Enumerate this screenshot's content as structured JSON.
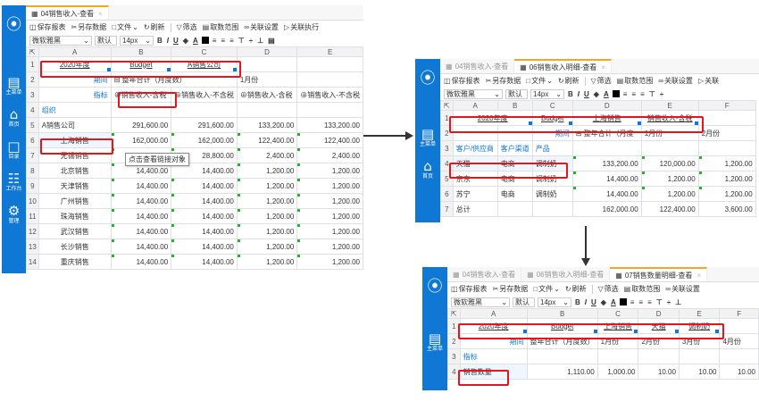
{
  "p1": {
    "tab": "04销售收入-查看",
    "toolbar": [
      "保存报表",
      "另存数据",
      "文件",
      "刷新",
      "筛选",
      "取数范围",
      "关联设置",
      "关联执行"
    ],
    "font": "微软雅黑",
    "style": "默认",
    "size": "14px",
    "cols": [
      "A",
      "B",
      "C",
      "D",
      "E"
    ],
    "rows": [
      {
        "n": "1",
        "c": [
          "2020年度",
          "Budget",
          "A销售公司",
          "",
          ""
        ]
      },
      {
        "n": "2",
        "c": [
          "期间",
          "⊟ 整年合计（月度数）",
          "",
          "1月份",
          ""
        ]
      },
      {
        "n": "3",
        "c": [
          "指标",
          "⊕销售收入-含税",
          "⊕销售收入-不含税",
          "⊕销售收入-含税",
          "⊕销售收入-不含税"
        ]
      },
      {
        "n": "4",
        "c": [
          "组织",
          "",
          "",
          "",
          ""
        ]
      },
      {
        "n": "5",
        "c": [
          "A销售公司",
          "291,600.00",
          "291,600.00",
          "133,200.00",
          "133,200.00"
        ]
      },
      {
        "n": "6",
        "c": [
          "上海销售",
          "162,000.00",
          "162,000.00",
          "122,400.00",
          "122,400.00"
        ]
      },
      {
        "n": "7",
        "c": [
          "无锡销售",
          "",
          "28,800.00",
          "2,400.00",
          "2,400.00"
        ]
      },
      {
        "n": "8",
        "c": [
          "北京销售",
          "14,400.00",
          "14,400.00",
          "1,200.00",
          "1,200.00"
        ]
      },
      {
        "n": "9",
        "c": [
          "天津销售",
          "14,400.00",
          "14,400.00",
          "1,200.00",
          "1,200.00"
        ]
      },
      {
        "n": "10",
        "c": [
          "广州销售",
          "14,400.00",
          "14,400.00",
          "1,200.00",
          "1,200.00"
        ]
      },
      {
        "n": "11",
        "c": [
          "珠海销售",
          "14,400.00",
          "14,400.00",
          "1,200.00",
          "1,200.00"
        ]
      },
      {
        "n": "12",
        "c": [
          "武汉销售",
          "14,400.00",
          "14,400.00",
          "1,200.00",
          "1,200.00"
        ]
      },
      {
        "n": "13",
        "c": [
          "长沙销售",
          "14,400.00",
          "14,400.00",
          "1,200.00",
          "1,200.00"
        ]
      },
      {
        "n": "14",
        "c": [
          "重庆销售",
          "14,400.00",
          "14,400.00",
          "1,200.00",
          "1,200.00"
        ]
      }
    ],
    "tooltip": "点击查看链接对象",
    "nav": [
      "主菜单",
      "首页",
      "目录",
      "工作台",
      "管理"
    ]
  },
  "p2": {
    "tabs": [
      "04销售收入-查看",
      "06销售收入明细-查看"
    ],
    "toolbar": [
      "保存报表",
      "另存数据",
      "文件",
      "刷新",
      "筛选",
      "取数范围",
      "关联设置",
      "关联"
    ],
    "font": "微软雅黑",
    "style": "默认",
    "size": "14px",
    "cols": [
      "A",
      "B",
      "C",
      "D",
      "E",
      "F"
    ],
    "rows": [
      {
        "n": "1",
        "c": [
          "2020年度",
          "",
          "Budget",
          "上海销售",
          "销售收入-含税",
          ""
        ]
      },
      {
        "n": "2",
        "c": [
          "",
          "",
          "期间",
          "⊟ 整年合计（月度",
          "1月份",
          "2月份"
        ]
      },
      {
        "n": "3",
        "c": [
          "客户/供应商",
          "客户渠道",
          "产品",
          "",
          "",
          ""
        ]
      },
      {
        "n": "4",
        "c": [
          "天猫",
          "电商",
          "调制奶",
          "133,200.00",
          "120,000.00",
          "1,200.00"
        ]
      },
      {
        "n": "5",
        "c": [
          "京东",
          "电商",
          "调制奶",
          "14,400.00",
          "1,200.00",
          "1,200.00"
        ]
      },
      {
        "n": "6",
        "c": [
          "苏宁",
          "电商",
          "调制奶",
          "14,400.00",
          "1,200.00",
          "1,200.00"
        ]
      },
      {
        "n": "7",
        "c": [
          "总计",
          "",
          "",
          "162,000.00",
          "122,400.00",
          "3,600.00"
        ]
      }
    ],
    "nav": [
      "主菜单",
      "首页"
    ]
  },
  "p3": {
    "tabs": [
      "04销售收入-查看",
      "06销售收入明细-查看",
      "07销售数量明细-查看"
    ],
    "toolbar": [
      "保存报表",
      "另存数据",
      "文件",
      "刷新",
      "筛选",
      "取数范围",
      "关联设置"
    ],
    "font": "微软雅黑",
    "style": "默认",
    "size": "14px",
    "cols": [
      "A",
      "B",
      "C",
      "D",
      "E",
      "F"
    ],
    "rows": [
      {
        "n": "1",
        "c": [
          "2020年度",
          "Budget",
          "上海销售",
          "天猫",
          "调制奶",
          ""
        ]
      },
      {
        "n": "2",
        "c": [
          "期间",
          "整年合计（月度数）",
          "1月份",
          "2月份",
          "3月份",
          "4月份"
        ]
      },
      {
        "n": "3",
        "c": [
          "指标",
          "",
          "",
          "",
          "",
          ""
        ]
      },
      {
        "n": "4",
        "c": [
          "销售数量",
          "1,110.00",
          "1,000.00",
          "10.00",
          "10.00",
          "10.00"
        ]
      }
    ],
    "nav": [
      "主菜单"
    ]
  },
  "colors": {
    "sidebar": "#0f78d4",
    "highlight": "#e5151b",
    "accent": "#f5a623"
  }
}
